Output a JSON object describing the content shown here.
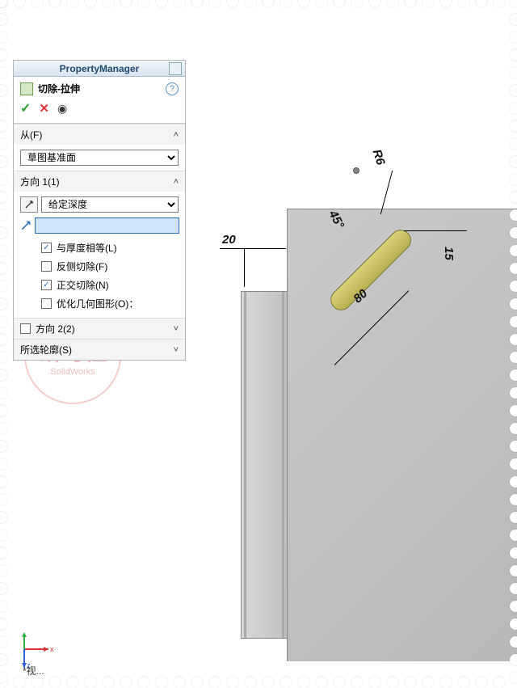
{
  "pm_title": "PropertyManager",
  "feature": {
    "name": "切除-拉伸"
  },
  "from": {
    "label": "从(F)",
    "value": "草图基准面"
  },
  "dir1": {
    "label": "方向 1(1)",
    "end_condition": "给定深度",
    "depth_value": "",
    "link_thickness": "与厚度相等(L)",
    "flip_side": "反侧切除(F)",
    "normal_cut": "正交切除(N)",
    "optimize": "优化几何图形(O)："
  },
  "dir2": {
    "label": "方向 2(2)"
  },
  "contours": {
    "label": "所选轮廓(S)"
  },
  "checks": {
    "link": true,
    "flip": false,
    "normal": true,
    "optimize": false,
    "dir2": false
  },
  "dims": {
    "r": "R6",
    "ang": "45°",
    "len": "80",
    "off_x": "20",
    "off_y": "15"
  },
  "watermark": {
    "main": "研习社",
    "sub": "SolidWorks"
  },
  "viewlabel": "*视..."
}
